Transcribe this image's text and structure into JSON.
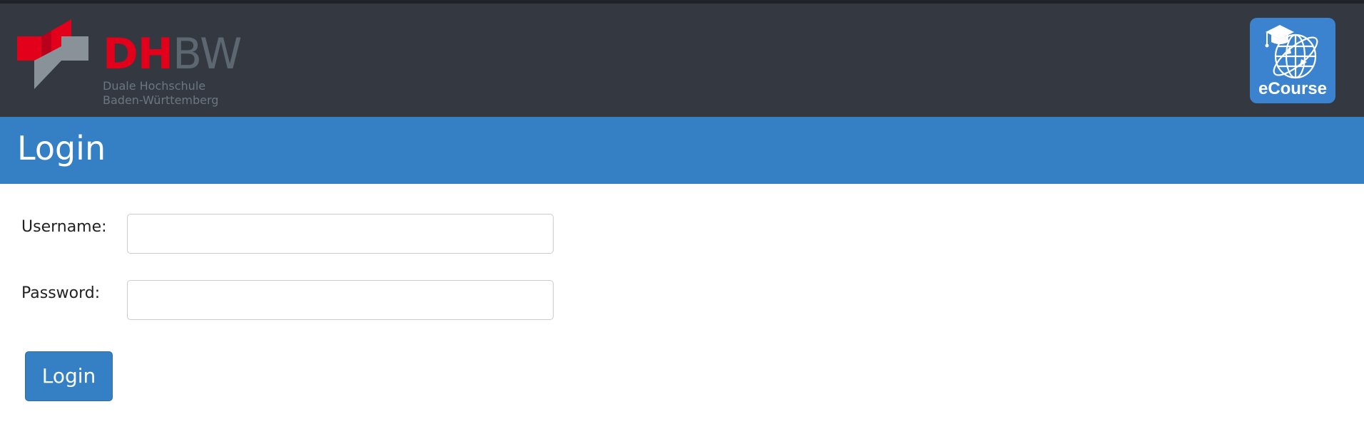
{
  "header": {
    "logo": {
      "word_red": "DH",
      "word_gray": "BW",
      "subtitle_line1": "Duale Hochschule",
      "subtitle_line2": "Baden-Württemberg",
      "icon": "dhbw-logo-mark"
    },
    "app_badge": {
      "label": "eCourse",
      "icon": "graduation-globe-icon"
    }
  },
  "page": {
    "title": "Login"
  },
  "form": {
    "username_label": "Username:",
    "username_value": "",
    "username_placeholder": "",
    "password_label": "Password:",
    "password_value": "",
    "password_placeholder": "",
    "submit_label": "Login"
  },
  "colors": {
    "header_bg": "#343941",
    "title_bar_bg": "#3580c5",
    "brand_red": "#e2001a",
    "brand_gray": "#5c6772",
    "badge_bg": "#3b82cf",
    "button_bg": "#3580c5"
  }
}
